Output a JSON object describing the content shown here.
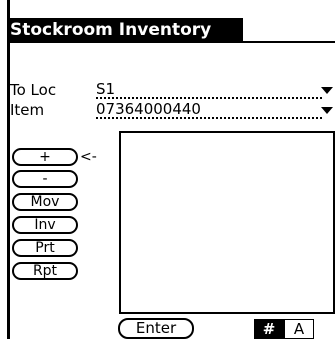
{
  "title": "Stockroom Inventory",
  "fields": {
    "to_loc": {
      "label": "To Loc",
      "value": "S1"
    },
    "item": {
      "label": "Item",
      "value": "07364000440"
    }
  },
  "commands": {
    "plus": "+",
    "minus": "-",
    "mov": "Mov",
    "inv": "Inv",
    "prt": "Prt",
    "rpt": "Rpt"
  },
  "selected_indicator": "<-",
  "enter_label": "Enter",
  "input_mode": {
    "numeric": "#",
    "alpha": "A",
    "active": "numeric"
  }
}
